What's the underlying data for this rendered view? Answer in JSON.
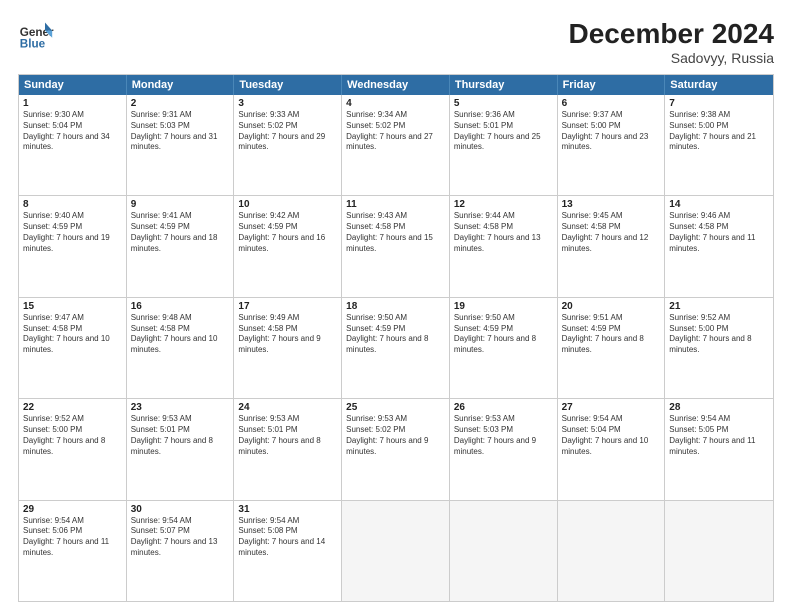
{
  "header": {
    "logo_line1": "General",
    "logo_line2": "Blue",
    "title": "December 2024",
    "subtitle": "Sadovyy, Russia"
  },
  "days_of_week": [
    "Sunday",
    "Monday",
    "Tuesday",
    "Wednesday",
    "Thursday",
    "Friday",
    "Saturday"
  ],
  "weeks": [
    [
      {
        "day": "1",
        "sunrise": "9:30 AM",
        "sunset": "5:04 PM",
        "daylight": "7 hours and 34 minutes."
      },
      {
        "day": "2",
        "sunrise": "9:31 AM",
        "sunset": "5:03 PM",
        "daylight": "7 hours and 31 minutes."
      },
      {
        "day": "3",
        "sunrise": "9:33 AM",
        "sunset": "5:02 PM",
        "daylight": "7 hours and 29 minutes."
      },
      {
        "day": "4",
        "sunrise": "9:34 AM",
        "sunset": "5:02 PM",
        "daylight": "7 hours and 27 minutes."
      },
      {
        "day": "5",
        "sunrise": "9:36 AM",
        "sunset": "5:01 PM",
        "daylight": "7 hours and 25 minutes."
      },
      {
        "day": "6",
        "sunrise": "9:37 AM",
        "sunset": "5:00 PM",
        "daylight": "7 hours and 23 minutes."
      },
      {
        "day": "7",
        "sunrise": "9:38 AM",
        "sunset": "5:00 PM",
        "daylight": "7 hours and 21 minutes."
      }
    ],
    [
      {
        "day": "8",
        "sunrise": "9:40 AM",
        "sunset": "4:59 PM",
        "daylight": "7 hours and 19 minutes."
      },
      {
        "day": "9",
        "sunrise": "9:41 AM",
        "sunset": "4:59 PM",
        "daylight": "7 hours and 18 minutes."
      },
      {
        "day": "10",
        "sunrise": "9:42 AM",
        "sunset": "4:59 PM",
        "daylight": "7 hours and 16 minutes."
      },
      {
        "day": "11",
        "sunrise": "9:43 AM",
        "sunset": "4:58 PM",
        "daylight": "7 hours and 15 minutes."
      },
      {
        "day": "12",
        "sunrise": "9:44 AM",
        "sunset": "4:58 PM",
        "daylight": "7 hours and 13 minutes."
      },
      {
        "day": "13",
        "sunrise": "9:45 AM",
        "sunset": "4:58 PM",
        "daylight": "7 hours and 12 minutes."
      },
      {
        "day": "14",
        "sunrise": "9:46 AM",
        "sunset": "4:58 PM",
        "daylight": "7 hours and 11 minutes."
      }
    ],
    [
      {
        "day": "15",
        "sunrise": "9:47 AM",
        "sunset": "4:58 PM",
        "daylight": "7 hours and 10 minutes."
      },
      {
        "day": "16",
        "sunrise": "9:48 AM",
        "sunset": "4:58 PM",
        "daylight": "7 hours and 10 minutes."
      },
      {
        "day": "17",
        "sunrise": "9:49 AM",
        "sunset": "4:58 PM",
        "daylight": "7 hours and 9 minutes."
      },
      {
        "day": "18",
        "sunrise": "9:50 AM",
        "sunset": "4:59 PM",
        "daylight": "7 hours and 8 minutes."
      },
      {
        "day": "19",
        "sunrise": "9:50 AM",
        "sunset": "4:59 PM",
        "daylight": "7 hours and 8 minutes."
      },
      {
        "day": "20",
        "sunrise": "9:51 AM",
        "sunset": "4:59 PM",
        "daylight": "7 hours and 8 minutes."
      },
      {
        "day": "21",
        "sunrise": "9:52 AM",
        "sunset": "5:00 PM",
        "daylight": "7 hours and 8 minutes."
      }
    ],
    [
      {
        "day": "22",
        "sunrise": "9:52 AM",
        "sunset": "5:00 PM",
        "daylight": "7 hours and 8 minutes."
      },
      {
        "day": "23",
        "sunrise": "9:53 AM",
        "sunset": "5:01 PM",
        "daylight": "7 hours and 8 minutes."
      },
      {
        "day": "24",
        "sunrise": "9:53 AM",
        "sunset": "5:01 PM",
        "daylight": "7 hours and 8 minutes."
      },
      {
        "day": "25",
        "sunrise": "9:53 AM",
        "sunset": "5:02 PM",
        "daylight": "7 hours and 9 minutes."
      },
      {
        "day": "26",
        "sunrise": "9:53 AM",
        "sunset": "5:03 PM",
        "daylight": "7 hours and 9 minutes."
      },
      {
        "day": "27",
        "sunrise": "9:54 AM",
        "sunset": "5:04 PM",
        "daylight": "7 hours and 10 minutes."
      },
      {
        "day": "28",
        "sunrise": "9:54 AM",
        "sunset": "5:05 PM",
        "daylight": "7 hours and 11 minutes."
      }
    ],
    [
      {
        "day": "29",
        "sunrise": "9:54 AM",
        "sunset": "5:06 PM",
        "daylight": "7 hours and 11 minutes."
      },
      {
        "day": "30",
        "sunrise": "9:54 AM",
        "sunset": "5:07 PM",
        "daylight": "7 hours and 13 minutes."
      },
      {
        "day": "31",
        "sunrise": "9:54 AM",
        "sunset": "5:08 PM",
        "daylight": "7 hours and 14 minutes."
      },
      null,
      null,
      null,
      null
    ]
  ]
}
